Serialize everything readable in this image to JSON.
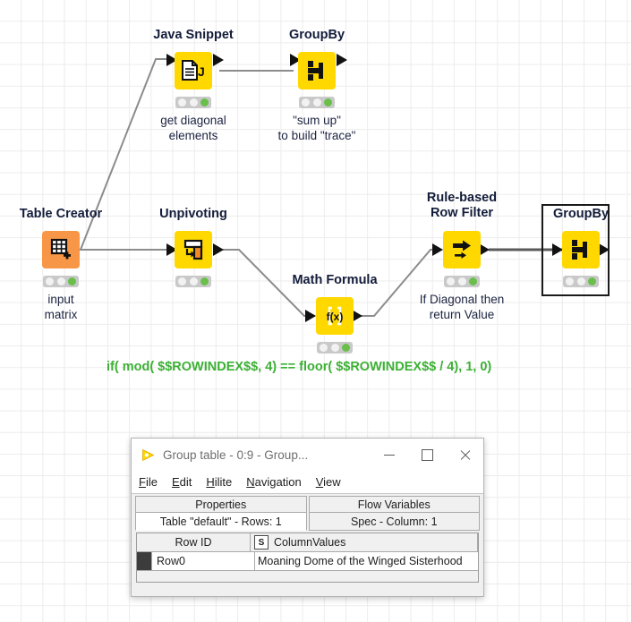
{
  "canvas": {
    "background_color": "#ffffff",
    "grid_color": "#ececec"
  },
  "workflow": {
    "node_title_color": "#131c3a",
    "annotation_color": "#1b2340",
    "node_yellow": "#ffd800",
    "node_orange": "#f79646",
    "status_ok_color": "#6abf4b",
    "formula_color": "#3cb034",
    "nodes": [
      {
        "id": "java-snippet",
        "title": "Java Snippet",
        "annotation": "get diagonal\nelements",
        "annotation_line1": "get diagonal",
        "annotation_line2": "elements",
        "icon": "java-document-icon",
        "color": "yellow",
        "status": "executed",
        "selected": false
      },
      {
        "id": "groupby-top",
        "title": "GroupBy",
        "annotation_line1": "\"sum up\"",
        "annotation_line2": "to build \"trace\"",
        "icon": "groupby-icon",
        "color": "yellow",
        "status": "executed",
        "selected": false
      },
      {
        "id": "table-creator",
        "title": "Table Creator",
        "annotation_line1": "input",
        "annotation_line2": "matrix",
        "icon": "table-plus-icon",
        "color": "orange",
        "status": "executed",
        "selected": false
      },
      {
        "id": "unpivoting",
        "title": "Unpivoting",
        "annotation_line1": "",
        "annotation_line2": "",
        "icon": "unpivot-icon",
        "color": "yellow",
        "status": "executed",
        "selected": false
      },
      {
        "id": "math-formula",
        "title": "Math Formula",
        "annotation_line1": "",
        "annotation_line2": "",
        "icon": "fx-icon",
        "color": "yellow",
        "status": "executed",
        "selected": false
      },
      {
        "id": "rule-based-row-filter",
        "title_line1": "Rule-based",
        "title_line2": "Row Filter",
        "annotation_line1": "If Diagonal then",
        "annotation_line2": "return Value",
        "icon": "row-filter-icon",
        "color": "yellow",
        "status": "executed",
        "selected": false
      },
      {
        "id": "groupby-right",
        "title": "GroupBy",
        "annotation_line1": "",
        "annotation_line2": "",
        "icon": "groupby-icon",
        "color": "yellow",
        "status": "executed",
        "selected": true
      }
    ],
    "formula_annotation": "if( mod( $$ROWINDEX$$, 4) == floor( $$ROWINDEX$$ / 4), 1, 0)"
  },
  "dialog": {
    "title": "Group table - 0:9 - Group...",
    "icon": "knime-triangle-icon",
    "window_buttons": {
      "minimize": "minimize-button",
      "maximize": "maximize-button",
      "close": "close-button"
    },
    "menu": [
      {
        "label": "File",
        "mnemonic": "F"
      },
      {
        "label": "Edit",
        "mnemonic": "E"
      },
      {
        "label": "Hilite",
        "mnemonic": "H"
      },
      {
        "label": "Navigation",
        "mnemonic": "N"
      },
      {
        "label": "View",
        "mnemonic": "V"
      }
    ],
    "tabs_row1": [
      {
        "label": "Properties",
        "selected": false
      },
      {
        "label": "Flow Variables",
        "selected": false
      }
    ],
    "tabs_row2": [
      {
        "label": "Table \"default\" - Rows: 1",
        "selected": true
      },
      {
        "label": "Spec - Column: 1",
        "selected": false
      }
    ],
    "table": {
      "columns": [
        {
          "label": "Row ID",
          "type_badge": ""
        },
        {
          "label": "ColumnValues",
          "type_badge": "S"
        }
      ],
      "rows": [
        {
          "row_id": "Row0",
          "value": "Moaning Dome of the Winged Sisterhood"
        }
      ]
    }
  }
}
